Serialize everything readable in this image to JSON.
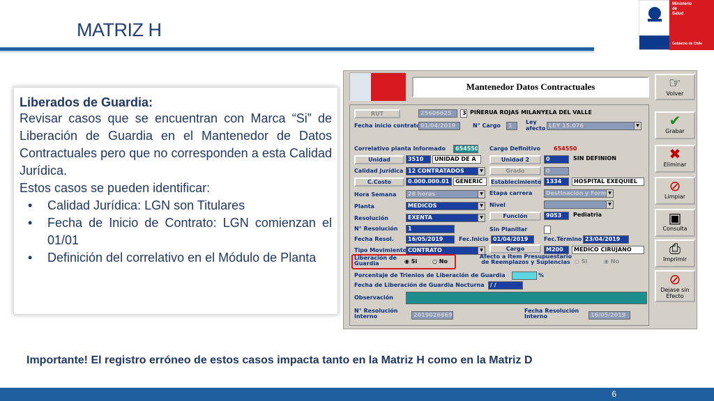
{
  "slide": {
    "title": "MATRIZ H",
    "page": "6",
    "important": "Importante! El registro erróneo de estos casos impacta tanto en la Matriz H como en la Matriz D"
  },
  "logo": {
    "l1": "Ministerio",
    "l2": "de",
    "l3": "Salud",
    "l4": "Gobierno de Chile"
  },
  "textbox": {
    "heading": "Liberados de Guardia:",
    "p1": "Revisar casos que se encuentran con Marca “Si” de Liberación de Guardia en el Mantenedor de Datos Contractuales pero que no corresponden a esta Calidad Jurídica.",
    "p2": "Estos casos se pueden identificar:",
    "bullets": [
      "Calidad Jurídica: LGN son Titulares",
      "Fecha de Inicio de Contrato: LGN comienzan el 01/01",
      "Definición del correlativo en el Módulo de Planta"
    ]
  },
  "app": {
    "title": "Mantenedor Datos Contractuales",
    "buttons": {
      "volver": "Volver",
      "grabar": "Grabar",
      "eliminar": "Eliminar",
      "limpiar": "Limpiar",
      "consulta": "Consulta",
      "imprimir": "Imprimir",
      "dejar": "Dejase sin Efecto"
    },
    "rut_btn": "RUT",
    "rut_val": "25606625",
    "rut_dv": "3",
    "name": "PIÑERUA ROJAS MILANYELA DEL VALLE",
    "fecha_inicio_lbl": "Fecha inicio contrato",
    "fecha_inicio": "01/04/2019",
    "ncargo_lbl": "N° Cargo",
    "ncargo": "1",
    "ley_lbl": "Ley afecto",
    "ley": "LEY 15.076",
    "correlativo_lbl": "Correlativo planta Informado",
    "correlativo": "654550",
    "cargo_def_lbl": "Cargo Definitivo",
    "cargo_def": "654550",
    "unidad_btn": "Unidad",
    "unidad_code": "3510",
    "unidad_name": "UNIDAD DE A",
    "unidad2_btn": "Unidad 2",
    "unidad2_code": "0",
    "unidad2_name": "SIN DEFINION",
    "calidad_lbl": "Calidad Jurídica",
    "calidad": "12 CONTRATADOS",
    "grado_btn": "Grado",
    "grado": "0",
    "ccosto_btn": "C.Costo",
    "ccosto": "0.000.000.01",
    "ccosto_name": "GENERIC",
    "estab_btn": "Establecimiento",
    "estab_code": "1334",
    "estab_name": "HOSPITAL EXEQUIEL",
    "hora_lbl": "Hora Semana",
    "hora": "28 horas",
    "etapa_lbl": "Etapa carrera",
    "etapa": "Destinación y Form",
    "planta_lbl": "Planta",
    "planta": "MEDICOS",
    "nivel_lbl": "Nivel",
    "nivel": "",
    "resol_lbl": "Resolución",
    "resol": "EXENTA",
    "funcion_btn": "Función",
    "funcion_code": "9053",
    "funcion_name": "Pediatria",
    "nresol_lbl": "N° Resolución",
    "nresol": "1",
    "sinplan_lbl": "Sin Planillar",
    "fresol_lbl": "Fecha Resol.",
    "fresol": "16/05/2019",
    "finicio_lbl": "Fec.Inicio",
    "finicio": "01/04/2019",
    "ftermino_lbl": "Fec.Término",
    "ftermino": "23/04/2019",
    "tipomov_lbl": "Tipo Movimiento",
    "tipomov": "CONTRATO",
    "cargo_btn": "Cargo",
    "cargo_code": "M200",
    "cargo_name": "MEDICO CIRUJANO",
    "lib_lbl": "Liberación de Guardia",
    "lib_si": "Si",
    "lib_no": "No",
    "afecto_lbl": "Afecto a Item Presupuestario de Reemplazos y Suplencias",
    "afecto_si": "Si",
    "afecto_no": "No",
    "trienios_lbl": "Porcentaje de Trienios de Liberación de Guardia",
    "pct": "%",
    "fliber_lbl": "Fecha de Liberación de Guardia Nocturna",
    "fliber": "/ /",
    "obs_lbl": "Observación",
    "nresint_lbl": "N° Resolución Interno",
    "nresint": "2019026669",
    "fresint_lbl": "Fecha Resolución Interno",
    "fresint": "16/05/2019"
  }
}
